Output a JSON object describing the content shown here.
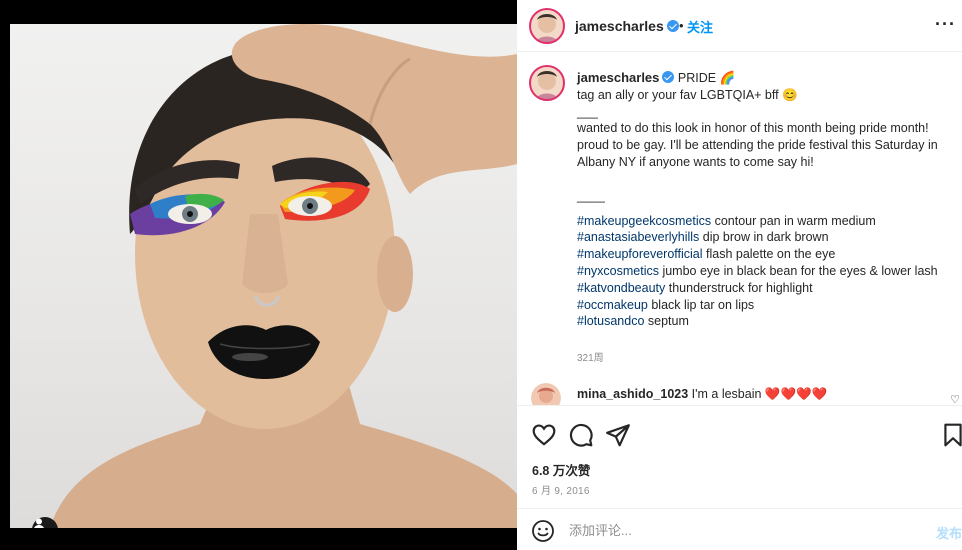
{
  "post": {
    "username": "jamescharles",
    "follow_label": "关注",
    "dot": "•",
    "more_label": "···",
    "caption": {
      "username": "jamescharles",
      "first_line": "PRIDE 🌈",
      "second_line": "tag an ally or your fav LGBTQIA+ bff 😊",
      "separator1": "___",
      "body": "wanted to do this look in honor of this month being pride month! proud to be gay. I'll be attending the pride festival this Saturday in Albany NY if anyone wants to come say hi!",
      "separator2": "____",
      "credits": [
        {
          "tag": "#makeupgeekcosmetics",
          "text": " contour pan in warm medium"
        },
        {
          "tag": "#anastasiabeverlyhills",
          "text": " dip brow in dark brown"
        },
        {
          "tag": "#makeupforeverofficial",
          "text": " flash palette on the eye"
        },
        {
          "tag": "#nyxcosmetics",
          "text": " jumbo eye in black bean for the eyes & lower lash"
        },
        {
          "tag": "#katvondbeauty",
          "text": " thunderstruck for highlight"
        },
        {
          "tag": "#occmakeup",
          "text": " black lip tar on lips"
        },
        {
          "tag": "#lotusandco",
          "text": " septum"
        }
      ],
      "age": "321周"
    },
    "comment": {
      "username": "mina_ashido_1023",
      "text": "I'm a lesbain ❤️❤️❤️❤️"
    },
    "likes": "6.8 万次赞",
    "date": "6 月 9, 2016",
    "comment_placeholder": "添加评论...",
    "post_label": "发布"
  },
  "icons": {
    "like": "heart-icon",
    "comment": "comment-icon",
    "share": "share-icon",
    "save": "bookmark-icon",
    "emoji": "emoji-icon",
    "tag": "user-tag-icon",
    "verified": "verified-badge-icon"
  },
  "colors": {
    "link_blue": "#0095f6",
    "hashtag": "#00376b",
    "muted": "#8e8e8e",
    "post_disabled": "#b2dffc",
    "heart_red": "#ed4956"
  }
}
